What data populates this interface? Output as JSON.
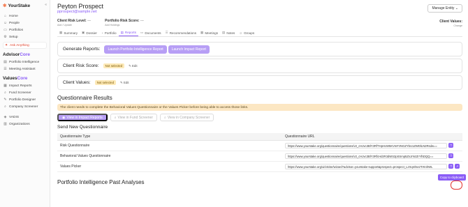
{
  "brand": {
    "name": "YourStake",
    "collapse_icon": "double-chevron-left-icon"
  },
  "sidebar": {
    "items_top": [
      {
        "label": "Home",
        "icon": "home-icon"
      },
      {
        "label": "People",
        "icon": "people-icon"
      },
      {
        "label": "Portfolios",
        "icon": "folder-icon"
      },
      {
        "label": "Setup",
        "icon": "gear-icon"
      }
    ],
    "ask": "Ask Anything",
    "advisor_core": {
      "part1": "Advisor",
      "part2": "Core"
    },
    "advisor_items": [
      {
        "label": "Portfolio Intelligence",
        "icon": "chart-icon"
      },
      {
        "label": "Meeting Assistant",
        "icon": "assistant-icon"
      }
    ],
    "values_core": {
      "part1": "Values",
      "part2": "Core"
    },
    "values_items": [
      {
        "label": "Impact Reports",
        "icon": "report-icon"
      },
      {
        "label": "Fund Screener",
        "icon": "search-icon"
      },
      {
        "label": "Portfolio Designer",
        "icon": "design-icon"
      },
      {
        "label": "Company Screener",
        "icon": "search-icon"
      }
    ],
    "bottom_items": [
      {
        "label": "VADIS",
        "icon": "vadis-icon"
      },
      {
        "label": "Organizations",
        "icon": "building-icon"
      }
    ]
  },
  "header": {
    "name": "Peyton Prospect",
    "email": "pprospect@sample.net",
    "manage_entity": "Manage Entity"
  },
  "metrics": {
    "risk_level": {
      "label": "Client Risk Level:",
      "value": "---",
      "sub": "Add / Update"
    },
    "risk_score": {
      "label": "Portfolio Risk Score:",
      "value": "---",
      "sub": "Add Holdings"
    },
    "client_values": {
      "label": "Client Values:",
      "sub": "Change"
    }
  },
  "tabs": [
    {
      "label": "Summary",
      "icon": "grid-icon"
    },
    {
      "label": "Dossier",
      "icon": "dossier-icon"
    },
    {
      "label": "Portfolio",
      "icon": "portfolio-icon"
    },
    {
      "label": "Reports",
      "icon": "report-icon",
      "active": true
    },
    {
      "label": "Documents",
      "icon": "folder-icon"
    },
    {
      "label": "Recommendations",
      "icon": "recommend-icon"
    },
    {
      "label": "Meetings",
      "icon": "calendar-icon"
    },
    {
      "label": "Notes",
      "icon": "notes-icon"
    },
    {
      "label": "Groups",
      "icon": "groups-icon"
    }
  ],
  "generate": {
    "title": "Generate Reports:",
    "btn1": "Launch Portfolio Intelligence Report",
    "btn2": "Launch Impact Report"
  },
  "risk_score_card": {
    "title": "Client Risk Score:",
    "badge": "Not selected",
    "edit": "Edit"
  },
  "values_card": {
    "title": "Client Values:",
    "badge": "Not selected",
    "edit": "Edit"
  },
  "questionnaire": {
    "title": "Questionnaire Results",
    "notice": "The client needs to complete the Behavioral Values Questionnaire or the Values Picker before being able to access those links.",
    "btn_impact": "View in Impact Reports",
    "btn_fund": "View in Fund Screener",
    "btn_company": "View in Company Screener",
    "send_title": "Send New Questionnaire",
    "col_type": "Questionnaire Type",
    "col_url": "Questionnaire URL",
    "rows": [
      {
        "type": "Risk Questionnaire",
        "url": "https://www.yourstake.org/questionnaire/questions/v2_cHJvc3BlY3RfTHpHcW5KVmFzNGZYbU1ZWDlLN2Rsdw=="
      },
      {
        "type": "Behavioral Values Questionnaire",
        "url": "https://www.yourstake.org/questionnaire/questions/v2_cHJvc3BlY3RfcHdzR3dWS2pSSmp5ZnJrNzZrYlhDQQ=="
      },
      {
        "type": "Values Picker",
        "url": "https://www.yourstake.org/ui/visitor/wizard?advisor=yourstake-support&prospect=prospect_LzXqn/tsezTrKnhWL"
      }
    ],
    "tooltip": "Copy to clipboard"
  },
  "past_title": "Portfolio Intelligence Past Analyses"
}
